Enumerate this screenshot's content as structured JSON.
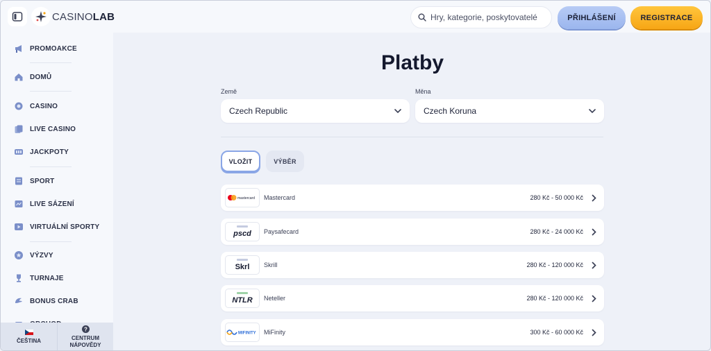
{
  "header": {
    "logo_text_a": "CASINO",
    "logo_text_b": "LAB",
    "search_placeholder": "Hry, kategorie, poskytovatelé",
    "login_label": "PŘIHLÁŠENÍ",
    "register_label": "REGISTRACE",
    "accent_login": "#9bb6ee",
    "accent_register": "#f7a615"
  },
  "sidebar": {
    "items": [
      {
        "label": "PROMOAKCE",
        "icon": "megaphone-icon"
      },
      {
        "label": "DOMŮ",
        "icon": "home-icon"
      },
      {
        "label": "CASINO",
        "icon": "chip-icon"
      },
      {
        "label": "LIVE CASINO",
        "icon": "cards-icon"
      },
      {
        "label": "JACKPOTY",
        "icon": "slot-icon"
      },
      {
        "label": "SPORT",
        "icon": "ticket-icon"
      },
      {
        "label": "LIVE SÁZENÍ",
        "icon": "live-bet-icon"
      },
      {
        "label": "VIRTUÁLNÍ SPORTY",
        "icon": "play-screen-icon"
      },
      {
        "label": "VÝZVY",
        "icon": "star-badge-icon"
      },
      {
        "label": "TURNAJE",
        "icon": "trophy-icon"
      },
      {
        "label": "BONUS CRAB",
        "icon": "crab-claw-icon"
      },
      {
        "label": "OBCHOD",
        "icon": "shop-icon"
      }
    ],
    "footer": {
      "language": "ČEŠTINA",
      "help_line1": "CENTRUM",
      "help_line2": "NÁPOVĚDY"
    }
  },
  "main": {
    "title": "Platby",
    "country_label": "Země",
    "country_value": "Czech Republic",
    "currency_label": "Měna",
    "currency_value": "Czech Koruna",
    "tabs": [
      {
        "label": "VLOŽIT",
        "active": true
      },
      {
        "label": "VÝBĚR",
        "active": false
      }
    ],
    "methods": [
      {
        "logo": "mastercard",
        "name": "Mastercard",
        "range": "280 Kč - 50 000 Kč"
      },
      {
        "logo": "pscd",
        "name": "Paysafecard",
        "range": "280 Kč - 24 000 Kč"
      },
      {
        "logo": "Skrl",
        "name": "Skrill",
        "range": "280 Kč - 120 000 Kč"
      },
      {
        "logo": "NTLR",
        "name": "Neteller",
        "range": "280 Kč - 120 000 Kč"
      },
      {
        "logo": "MIFINITY",
        "name": "MiFinity",
        "range": "300 Kč - 60 000 Kč"
      }
    ]
  }
}
